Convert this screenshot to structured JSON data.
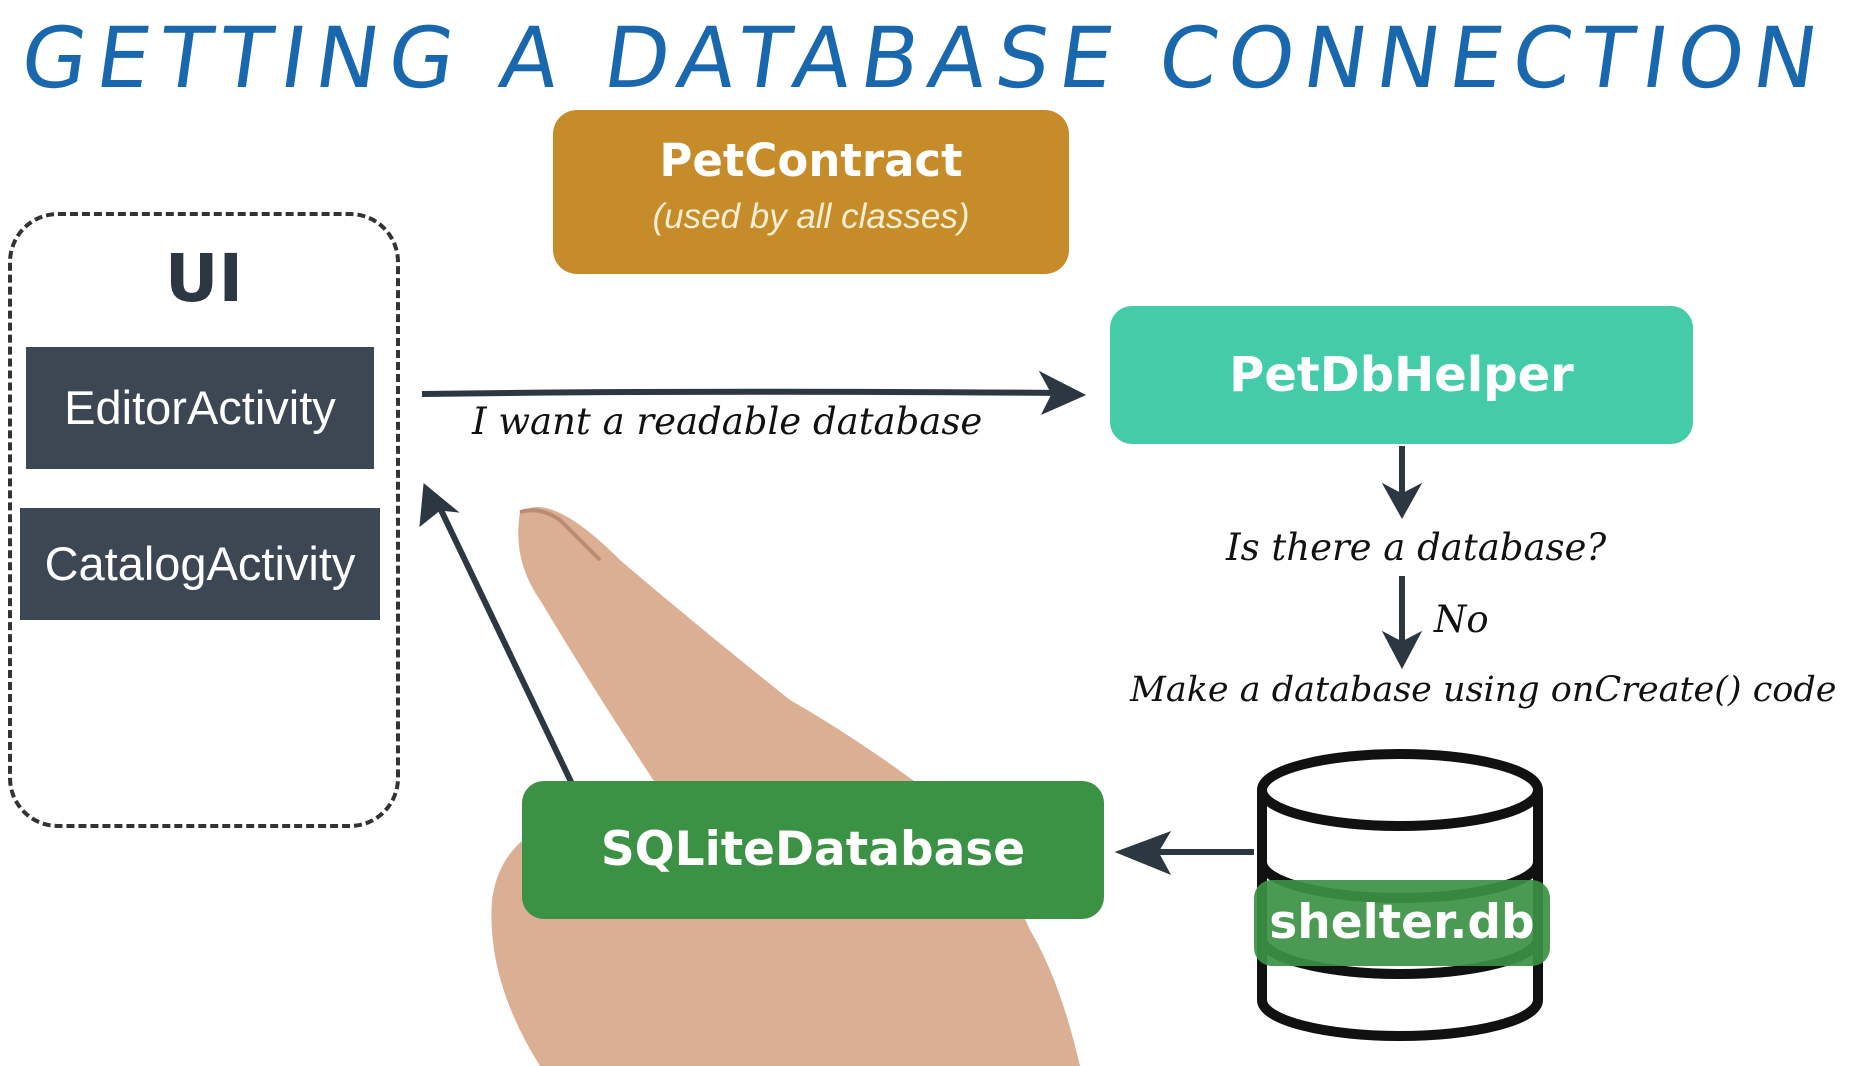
{
  "title": "GETTING A DATABASE CONNECTION",
  "pet_contract": {
    "name": "PetContract",
    "subtitle": "(used by all classes)"
  },
  "ui_group": {
    "label": "UI",
    "activities": [
      "EditorActivity",
      "CatalogActivity"
    ]
  },
  "request_label": "I want a readable database",
  "db_helper": "PetDbHelper",
  "question": "Is there a database?",
  "answer": "No",
  "create_step": "Make a database using onCreate() code",
  "db_file": "shelter.db",
  "sqlite": "SQLiteDatabase",
  "colors": {
    "title": "#1967ac",
    "pet_contract": "#c68c2a",
    "db_helper": "#44cca9",
    "sqlite": "#3b9144",
    "ui_box": "#3c4753",
    "arrow": "#2d3741"
  }
}
